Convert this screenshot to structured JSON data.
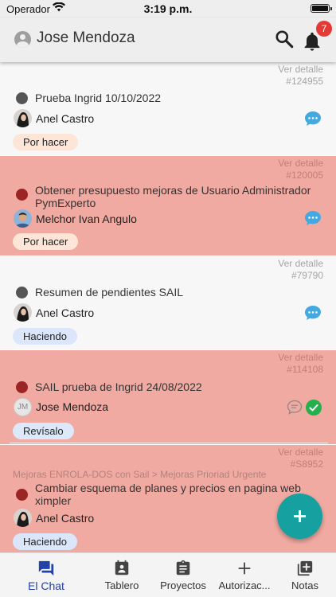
{
  "status_bar": {
    "carrier": "Operador",
    "time": "3:19 p.m."
  },
  "header": {
    "user_name": "Jose Mendoza",
    "notification_count": "7"
  },
  "detail_label": "Ver detalle",
  "tasks": [
    {
      "detail": "Ver detalle",
      "id": "#124955",
      "title": "Prueba Ingrid 10/10/2022",
      "person": "Anel Castro",
      "status": "Por hacer",
      "dot_color": "#555555",
      "card_color": "white"
    },
    {
      "detail": "Ver detalle",
      "id": "#120005",
      "title": "Obtener presupuesto mejoras de Usuario Administrador PymExperto",
      "person": "Melchor Ivan Angulo",
      "status": "Por hacer",
      "dot_color": "#9b2424",
      "card_color": "red"
    },
    {
      "detail": "Ver detalle",
      "id": "#79790",
      "title": "Resumen de pendientes SAIL",
      "person": "Anel Castro",
      "status": "Haciendo",
      "dot_color": "#555555",
      "card_color": "white"
    },
    {
      "detail": "Ver detalle",
      "id": "#114108",
      "title": "SAIL prueba de Ingrid 24/08/2022",
      "person": "Jose Mendoza",
      "person_initials": "JM",
      "status": "Revísalo",
      "dot_color": "#9b2424",
      "card_color": "red"
    },
    {
      "detail": "Ver detalle",
      "id": "#S8952",
      "breadcrumb": "Mejoras ENROLA-DOS con Sail > Mejoras Prioriad Urgente",
      "title": "Cambiar esquema de planes y precios en pagina web ximpler",
      "person": "Anel Castro",
      "status": "Haciendo",
      "dot_color": "#9b2424",
      "card_color": "red"
    }
  ],
  "status_colors": {
    "Por hacer": "#fde6d8",
    "Haciendo": "#dbe6fb",
    "Revísalo": "#dde8fb"
  },
  "nav": [
    {
      "label": "El Chat",
      "icon": "chat-icon",
      "active": true
    },
    {
      "label": "Tablero",
      "icon": "board-icon",
      "active": false
    },
    {
      "label": "Proyectos",
      "icon": "clipboard-icon",
      "active": false
    },
    {
      "label": "Autorizac...",
      "icon": "plus-icon",
      "active": false
    },
    {
      "label": "Notas",
      "icon": "notes-add-icon",
      "active": false
    }
  ],
  "colors": {
    "accent": "#2342a8",
    "fab": "#17a0a0",
    "overdue_card": "#f1aaa1",
    "normal_card": "#f7f7f7",
    "badge": "#e53935",
    "chat_bubble": "#44a9e0",
    "check": "#22b14c"
  }
}
